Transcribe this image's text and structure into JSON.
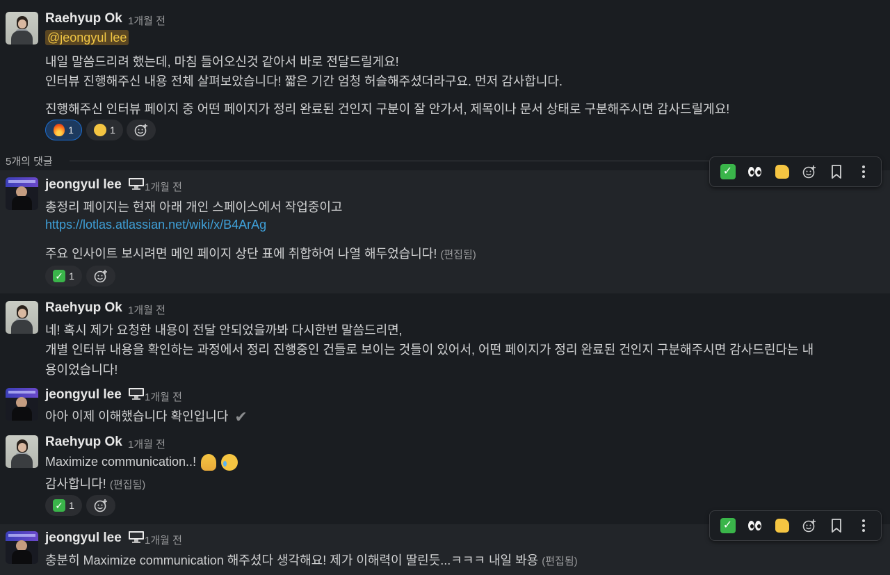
{
  "colors": {
    "background": "#1a1d21",
    "highlight_row": "#222529",
    "mention_bg": "#5a4622",
    "mention_text": "#f2c744",
    "link": "#3fa0d8",
    "reaction_selected": "#1d3a5f"
  },
  "messages": [
    {
      "author": "Raehyup Ok",
      "time": "1개월 전",
      "mention": "@jeongyul lee",
      "lines": [
        "내일 말씀드리려 했는데, 마침 들어오신것 같아서 바로 전달드릴게요!",
        "인터뷰 진행해주신 내용 전체 살펴보았습니다! 짧은 기간 엄청 허슬해주셨더라구요. 먼저 감사합니다.",
        "진행해주신 인터뷰 페이지 중 어떤 페이지가 정리 완료된 건인지 구분이 잘 안가서, 제목이나 문서 상태로 구분해주시면 감사드릴게요!"
      ],
      "reactions": [
        {
          "emoji": "fire-emoji",
          "count": "1"
        },
        {
          "emoji": "party-face-emoji",
          "count": "1"
        }
      ]
    }
  ],
  "thread": {
    "replies_label": "5개의 댓글"
  },
  "replies": [
    {
      "author": "jeongyul lee",
      "status_icon": "monitor-icon",
      "time": "1개월 전",
      "line1": "총정리 페이지는 현재 아래 개인 스페이스에서 작업중이고",
      "link": "https://lotlas.atlassian.net/wiki/x/B4ArAg",
      "line3": "주요 인사이트 보시려면 메인 페이지 상단 표에 취합하여 나열 해두었습니다!",
      "edited": "(편집됨)",
      "reaction_count": "1"
    },
    {
      "author": "Raehyup Ok",
      "time": "1개월 전",
      "line1": "네! 혹시 제가 요청한 내용이 전달 안되었을까봐 다시한번 말씀드리면,",
      "line2": "개별 인터뷰 내용을 확인하는 과정에서 정리 진행중인 건들로 보이는 것들이 있어서, 어떤 페이지가 정리 완료된 건인지 구분해주시면 감사드린다는 내",
      "line3": "용이었습니다!"
    },
    {
      "author": "jeongyul lee",
      "status_icon": "monitor-icon",
      "time": "1개월 전",
      "line1": "아아 이제 이해했습니다 확인입니다"
    },
    {
      "author": "Raehyup Ok",
      "time": "1개월 전",
      "line1": "Maximize communication..!",
      "line2": "감사합니다!",
      "edited": "(편집됨)",
      "reaction_count": "1"
    },
    {
      "author": "jeongyul lee",
      "status_icon": "monitor-icon",
      "time": "1개월 전",
      "line1": "충분히 Maximize communication 해주셨다 생각해요! 제가 이해력이 딸린듯...ㅋㅋㅋ 내일 봐용",
      "edited": "(편집됨)"
    }
  ],
  "toolbar_actions": [
    "check-reaction",
    "eyes-reaction",
    "thumbs-up-reaction",
    "add-reaction",
    "save-for-later",
    "more-actions"
  ]
}
